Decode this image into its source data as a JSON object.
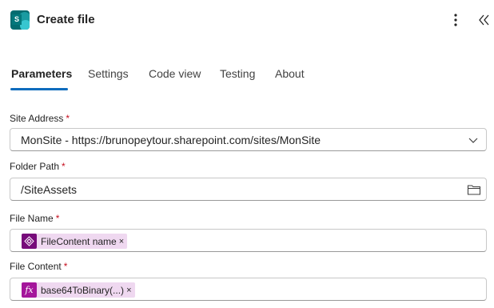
{
  "header": {
    "title": "Create file",
    "app_icon_letter": "S",
    "more_icon": "more-vertical-icon",
    "collapse_icon": "double-chevron-left-icon"
  },
  "tabs": [
    {
      "label": "Parameters",
      "active": true
    },
    {
      "label": "Settings",
      "active": false
    },
    {
      "label": "Code view",
      "active": false
    },
    {
      "label": "Testing",
      "active": false
    },
    {
      "label": "About",
      "active": false
    }
  ],
  "fields": {
    "site_address": {
      "label": "Site Address",
      "required_mark": "*",
      "value": "MonSite - https://brunopeytour.sharepoint.com/sites/MonSite"
    },
    "folder_path": {
      "label": "Folder Path",
      "required_mark": "*",
      "value": "/SiteAssets"
    },
    "file_name": {
      "label": "File Name",
      "required_mark": "*",
      "token": {
        "label": "FileContent name",
        "remove": "×",
        "icon": "variable-icon"
      }
    },
    "file_content": {
      "label": "File Content",
      "required_mark": "*",
      "token": {
        "label": "base64ToBinary(...)",
        "remove": "×",
        "icon": "fx-icon",
        "icon_text": "fx"
      }
    }
  },
  "colors": {
    "accent": "#0f6cbd",
    "required": "#c50f1f",
    "token_bg": "#efd8f0",
    "variable_token": "#770b7a",
    "expression_token": "#a4169b",
    "sharepoint": "#036c70"
  }
}
